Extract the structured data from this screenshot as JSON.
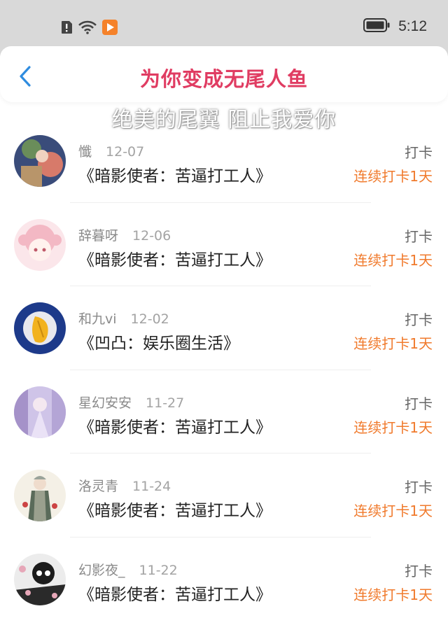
{
  "status_bar": {
    "time": "5:12",
    "icons": [
      "alert-icon",
      "wifi-icon",
      "video-app-icon",
      "battery-icon"
    ]
  },
  "header": {
    "title": "为你变成无尾人鱼",
    "back_icon": "chevron-left-icon"
  },
  "overlay": {
    "subtitle": "绝美的尾翼 阻止我爱你"
  },
  "colors": {
    "title": "#e03c62",
    "streak": "#f07a2c",
    "status_bar": "#d9d9d9"
  },
  "feed": {
    "items": [
      {
        "user": "懺",
        "date": "12-07",
        "book": "《暗影使者：苦逼打工人》",
        "action": "打卡",
        "streak": "连续打卡1天"
      },
      {
        "user": "辞暮呀",
        "date": "12-06",
        "book": "《暗影使者：苦逼打工人》",
        "action": "打卡",
        "streak": "连续打卡1天"
      },
      {
        "user": "和九vi",
        "date": "12-02",
        "book": "《凹凸：娱乐圈生活》",
        "action": "打卡",
        "streak": "连续打卡1天"
      },
      {
        "user": "星幻安安",
        "date": "11-27",
        "book": "《暗影使者：苦逼打工人》",
        "action": "打卡",
        "streak": "连续打卡1天"
      },
      {
        "user": "洛灵青",
        "date": "11-24",
        "book": "《暗影使者：苦逼打工人》",
        "action": "打卡",
        "streak": "连续打卡1天"
      },
      {
        "user": "幻影夜_",
        "date": "11-22",
        "book": "《暗影使者：苦逼打工人》",
        "action": "打卡",
        "streak": "连续打卡1天"
      }
    ]
  }
}
